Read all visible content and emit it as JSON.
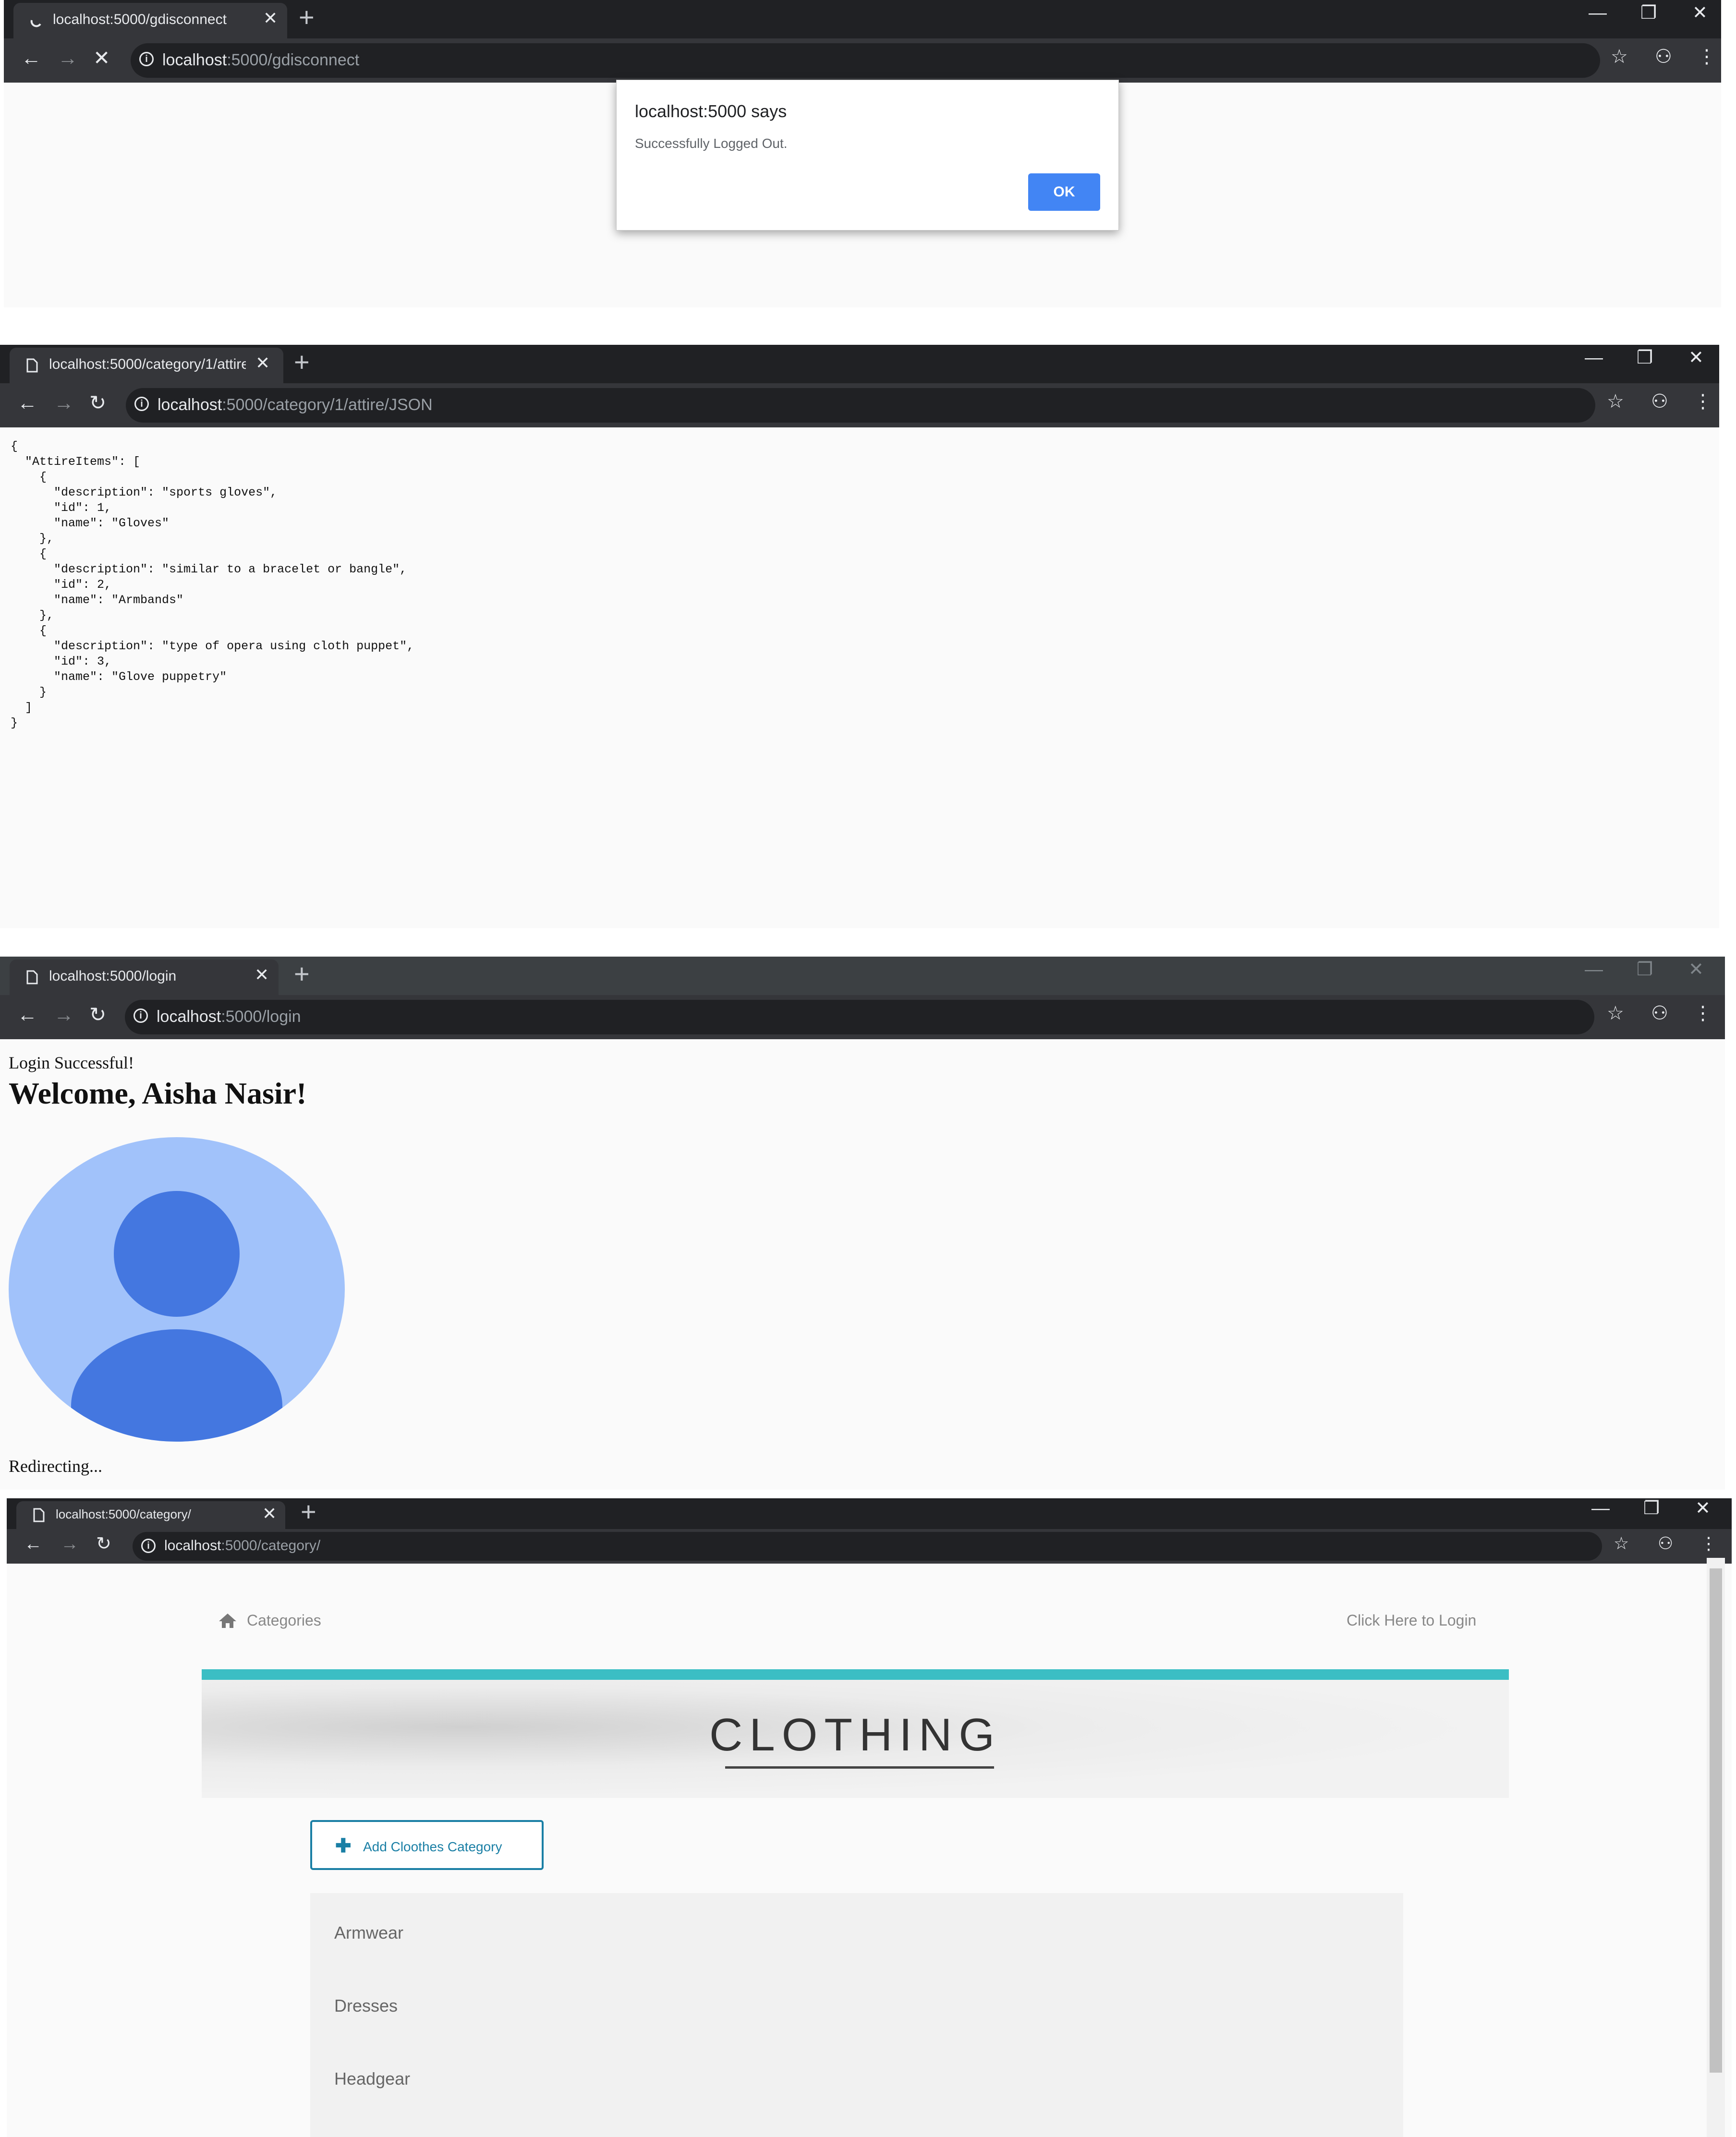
{
  "panel1": {
    "tab_title": "localhost:5000/gdisconnect",
    "url_host": "localhost",
    "url_rest": ":5000/gdisconnect",
    "dialog": {
      "title": "localhost:5000 says",
      "message": "Successfully Logged Out.",
      "ok_label": "OK"
    }
  },
  "panel2": {
    "tab_title": "localhost:5000/category/1/attire/",
    "url_host": "localhost",
    "url_rest": ":5000/category/1/attire/JSON",
    "json_text": "{\n  \"AttireItems\": [\n    {\n      \"description\": \"sports gloves\",\n      \"id\": 1,\n      \"name\": \"Gloves\"\n    },\n    {\n      \"description\": \"similar to a bracelet or bangle\",\n      \"id\": 2,\n      \"name\": \"Armbands\"\n    },\n    {\n      \"description\": \"type of opera using cloth puppet\",\n      \"id\": 3,\n      \"name\": \"Glove puppetry\"\n    }\n  ]\n}"
  },
  "panel3": {
    "tab_title": "localhost:5000/login",
    "url_host": "localhost",
    "url_rest": ":5000/login",
    "login_message": "Login Successful!",
    "welcome": "Welcome, Aisha Nasir!",
    "redirect_message": "Redirecting..."
  },
  "panel4": {
    "tab_title": "localhost:5000/category/",
    "url_host": "localhost",
    "url_rest": ":5000/category/",
    "nav_categories": "Categories",
    "nav_login": "Click Here to Login",
    "banner_title": "CLOTHING",
    "add_button": "Add Cloothes Category",
    "categories": [
      "Armwear",
      "Dresses",
      "Headgear"
    ]
  },
  "colors": {
    "accent_bar": "#3bbec4",
    "add_button": "#1a7fa5",
    "dialog_ok": "#4285f4",
    "avatar_bg": "#a1c2fa",
    "avatar_fg": "#4477e0"
  }
}
